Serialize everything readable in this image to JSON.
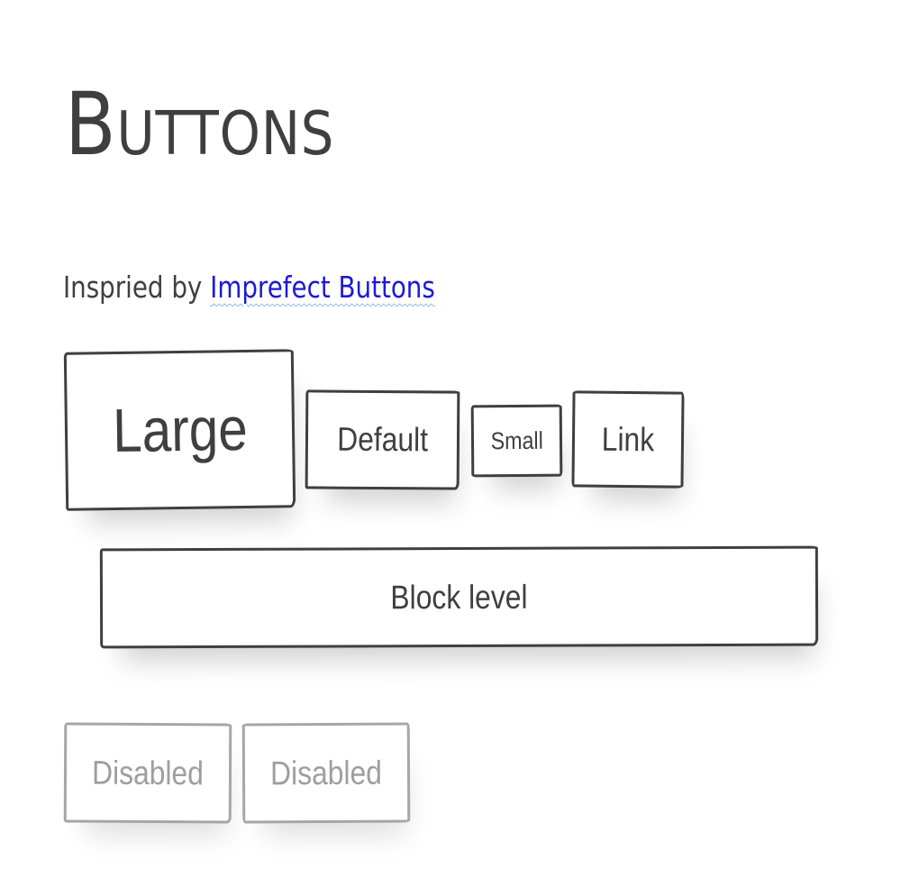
{
  "page": {
    "title": "Buttons",
    "intro_text": "Inspried by ",
    "intro_link": "Imprefect Buttons"
  },
  "buttons": {
    "large": "Large",
    "default": "Default",
    "small": "Small",
    "link": "Link",
    "block": "Block level",
    "disabled_1": "Disabled",
    "disabled_2": "Disabled"
  },
  "colors": {
    "text": "#3f3f3f",
    "border": "#3f3f3f",
    "link": "#1a1ad6",
    "disabled_text": "#9e9e9e",
    "disabled_border": "#a6a6a6",
    "background": "#ffffff"
  }
}
